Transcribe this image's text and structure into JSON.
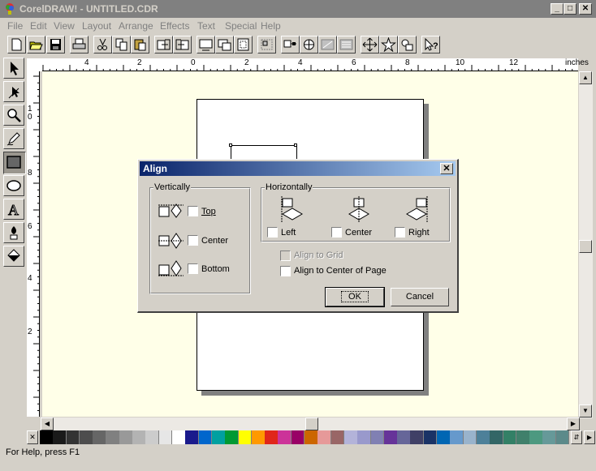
{
  "window": {
    "title": "CorelDRAW! - UNTITLED.CDR",
    "minimize": "_",
    "maximize": "□",
    "close": "✕"
  },
  "menu": [
    "File",
    "Edit",
    "View",
    "Layout",
    "Arrange",
    "Effects",
    "Text",
    "Special",
    "Help"
  ],
  "toolbar_icons": [
    "new-icon",
    "open-icon",
    "save-icon",
    "print-icon",
    "cut-icon",
    "copy-icon",
    "paste-icon",
    "import-icon",
    "export-icon",
    "wireframe-icon",
    "full-screen-icon",
    "zoom-page-icon",
    "group-icon",
    "node-edit-icon",
    "combine-icon",
    "break-apart-icon",
    "move-icon",
    "star-icon",
    "shape-icon",
    "context-help-icon"
  ],
  "tools": [
    "pick-tool-icon",
    "shape-tool-icon",
    "zoom-tool-icon",
    "pencil-tool-icon",
    "rectangle-tool-icon",
    "ellipse-tool-icon",
    "text-tool-icon",
    "outline-tool-icon",
    "fill-tool-icon"
  ],
  "rulers": {
    "unit": "inches",
    "h_labels": [
      "4",
      "2",
      "0",
      "2",
      "4",
      "6",
      "8",
      "10",
      "12"
    ],
    "v_labels": [
      "1\n0",
      "8",
      "6",
      "4",
      "2"
    ]
  },
  "palette": [
    "#000000",
    "#1a1a1a",
    "#333333",
    "#4d4d4d",
    "#666666",
    "#808080",
    "#999999",
    "#b3b3b3",
    "#cccccc",
    "#e6e6e6",
    "#ffffff",
    "#1a1a8c",
    "#0066cc",
    "#00a0a0",
    "#009933",
    "#ffff00",
    "#ff9900",
    "#e0261a",
    "#cc3399",
    "#990066",
    "#cc6600",
    "#e69999",
    "#996666",
    "#b3b3d9",
    "#9999cc",
    "#8080b3",
    "#663399",
    "#666699",
    "#404066",
    "#1a3366",
    "#0066b3",
    "#6699cc",
    "#99b3cc",
    "#4d8099",
    "#336666",
    "#338066",
    "#40806b",
    "#4d9980",
    "#669999",
    "#5c8a8a"
  ],
  "status": "For Help, press F1",
  "dialog": {
    "title": "Align",
    "close": "✕",
    "vertically": {
      "legend": "Vertically",
      "options": [
        "Top",
        "Center",
        "Bottom"
      ]
    },
    "horizontally": {
      "legend": "Horizontally",
      "options": [
        "Left",
        "Center",
        "Right"
      ]
    },
    "align_to_grid": "Align to Grid",
    "align_to_center": "Align to Center of Page",
    "ok": "OK",
    "cancel": "Cancel"
  }
}
